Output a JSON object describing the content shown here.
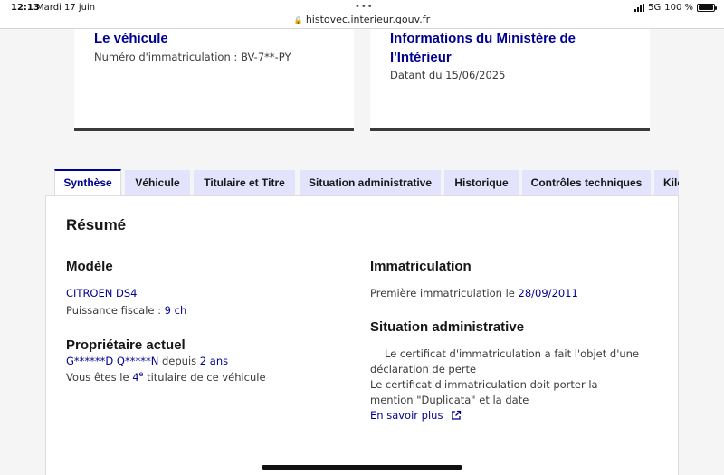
{
  "status_bar": {
    "time": "12:13",
    "date": "Mardi 17 juin",
    "url": "histovec.interieur.gouv.fr",
    "network": "5G",
    "battery": "100 %",
    "battery_level": 1.0
  },
  "cards": {
    "vehicle": {
      "title": "Le véhicule",
      "plate_label": "Numéro d'immatriculation : BV-7**-PY"
    },
    "ministry": {
      "title": "Informations du Ministère de l'Intérieur",
      "date_label": "Datant du 15/06/2025"
    }
  },
  "tabs": [
    {
      "label": "Synthèse",
      "active": true
    },
    {
      "label": "Véhicule",
      "active": false
    },
    {
      "label": "Titulaire et Titre",
      "active": false
    },
    {
      "label": "Situation administrative",
      "active": false
    },
    {
      "label": "Historique",
      "active": false
    },
    {
      "label": "Contrôles techniques",
      "active": false
    },
    {
      "label": "Kilo",
      "active": false
    }
  ],
  "summary": {
    "title": "Résumé",
    "model": {
      "heading": "Modèle",
      "name": "CITROEN DS4",
      "power_label": "Puissance fiscale : ",
      "power_value": "9 ch"
    },
    "owner": {
      "heading": "Propriétaire actuel",
      "name": "G******D Q*****N",
      "since_label": " depuis ",
      "since_value": "2 ans",
      "rank_prefix": "Vous êtes le ",
      "rank_number": "4",
      "rank_suffix_sup": "e",
      "rank_suffix": " titulaire de ce véhicule"
    },
    "registration": {
      "heading": "Immatriculation",
      "first_label": "Première immatriculation le ",
      "first_date": "28/09/2011"
    },
    "admin": {
      "heading": "Situation administrative",
      "line1": "Le certificat d'immatriculation a fait l'objet d'une déclaration de perte",
      "line2": "Le certificat d'immatriculation doit porter la mention \"Duplicata\" et la date",
      "link": "En savoir plus"
    }
  }
}
